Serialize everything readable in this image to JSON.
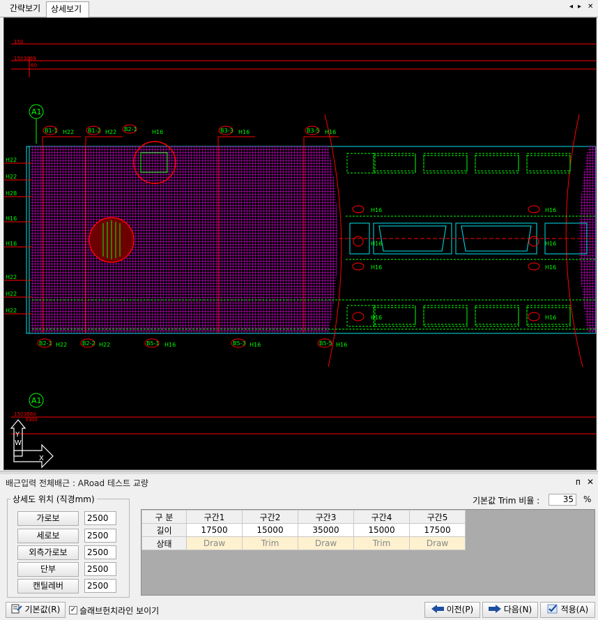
{
  "tabs": [
    {
      "label": "간략보기"
    },
    {
      "label": "상세보기"
    }
  ],
  "tab_controls": {
    "prev": "◂",
    "next": "▸",
    "close": "✕"
  },
  "drawing": {
    "axis_top": "A1",
    "axis_bottom": "A1",
    "dims_top": [
      "150",
      "150",
      "3069",
      "60"
    ],
    "dims_bottom": [
      "150",
      "3660",
      "3300"
    ],
    "left_marks": [
      "H22",
      "H22",
      "H28",
      "H16",
      "H16",
      "H22",
      "H22",
      "H22"
    ],
    "top_tags": [
      {
        "tag": "B1-1",
        "bar": "H22"
      },
      {
        "tag": "B1-2",
        "bar": "H22"
      },
      {
        "tag": "B2-1",
        "bar": "H16"
      },
      {
        "tag": "B3-3",
        "bar": "H16"
      },
      {
        "tag": "B3-5",
        "bar": "H16"
      }
    ],
    "bottom_tags": [
      {
        "tag": "B2-1",
        "bar": "H22"
      },
      {
        "tag": "B2-2",
        "bar": "H22"
      },
      {
        "tag": "B5-1",
        "bar": "H16"
      },
      {
        "tag": "B5-3",
        "bar": "H16"
      },
      {
        "tag": "B5-5",
        "bar": "H16"
      }
    ],
    "mid_bar": "H16",
    "ucs_y": "Y",
    "ucs_w": "W",
    "ucs_x": "X"
  },
  "panel": {
    "title": "배근입력 전체배근 : ARoad 테스트 교량",
    "pin": "ᴨ",
    "close": "✕"
  },
  "position_group": {
    "legend": "상세도 위치 (직경mm)",
    "rows": [
      {
        "label": "가로보",
        "value": "2500"
      },
      {
        "label": "세로보",
        "value": "2500"
      },
      {
        "label": "외측가로보",
        "value": "2500"
      },
      {
        "label": "단부",
        "value": "2500"
      },
      {
        "label": "캔틸레버",
        "value": "2500"
      }
    ]
  },
  "trim": {
    "label": "기본값 Trim 비율 :",
    "value": "35",
    "unit": "%"
  },
  "grid": {
    "corner": "구 분",
    "columns": [
      "구간1",
      "구간2",
      "구간3",
      "구간4",
      "구간5"
    ],
    "length_label": "길이",
    "lengths": [
      "17500",
      "15000",
      "35000",
      "15000",
      "17500"
    ],
    "state_label": "상태",
    "states": [
      "Draw",
      "Trim",
      "Draw",
      "Trim",
      "Draw"
    ]
  },
  "buttons": {
    "default": "기본값(R)",
    "show_line": "슬래브헌치라인 보이기",
    "prev": "이전(P)",
    "next": "다음(N)",
    "apply": "적용(A)"
  },
  "colors": {
    "magenta": "#ff00ff",
    "green": "#00ff00",
    "red": "#ff0000",
    "cyan": "#00e5ee"
  }
}
